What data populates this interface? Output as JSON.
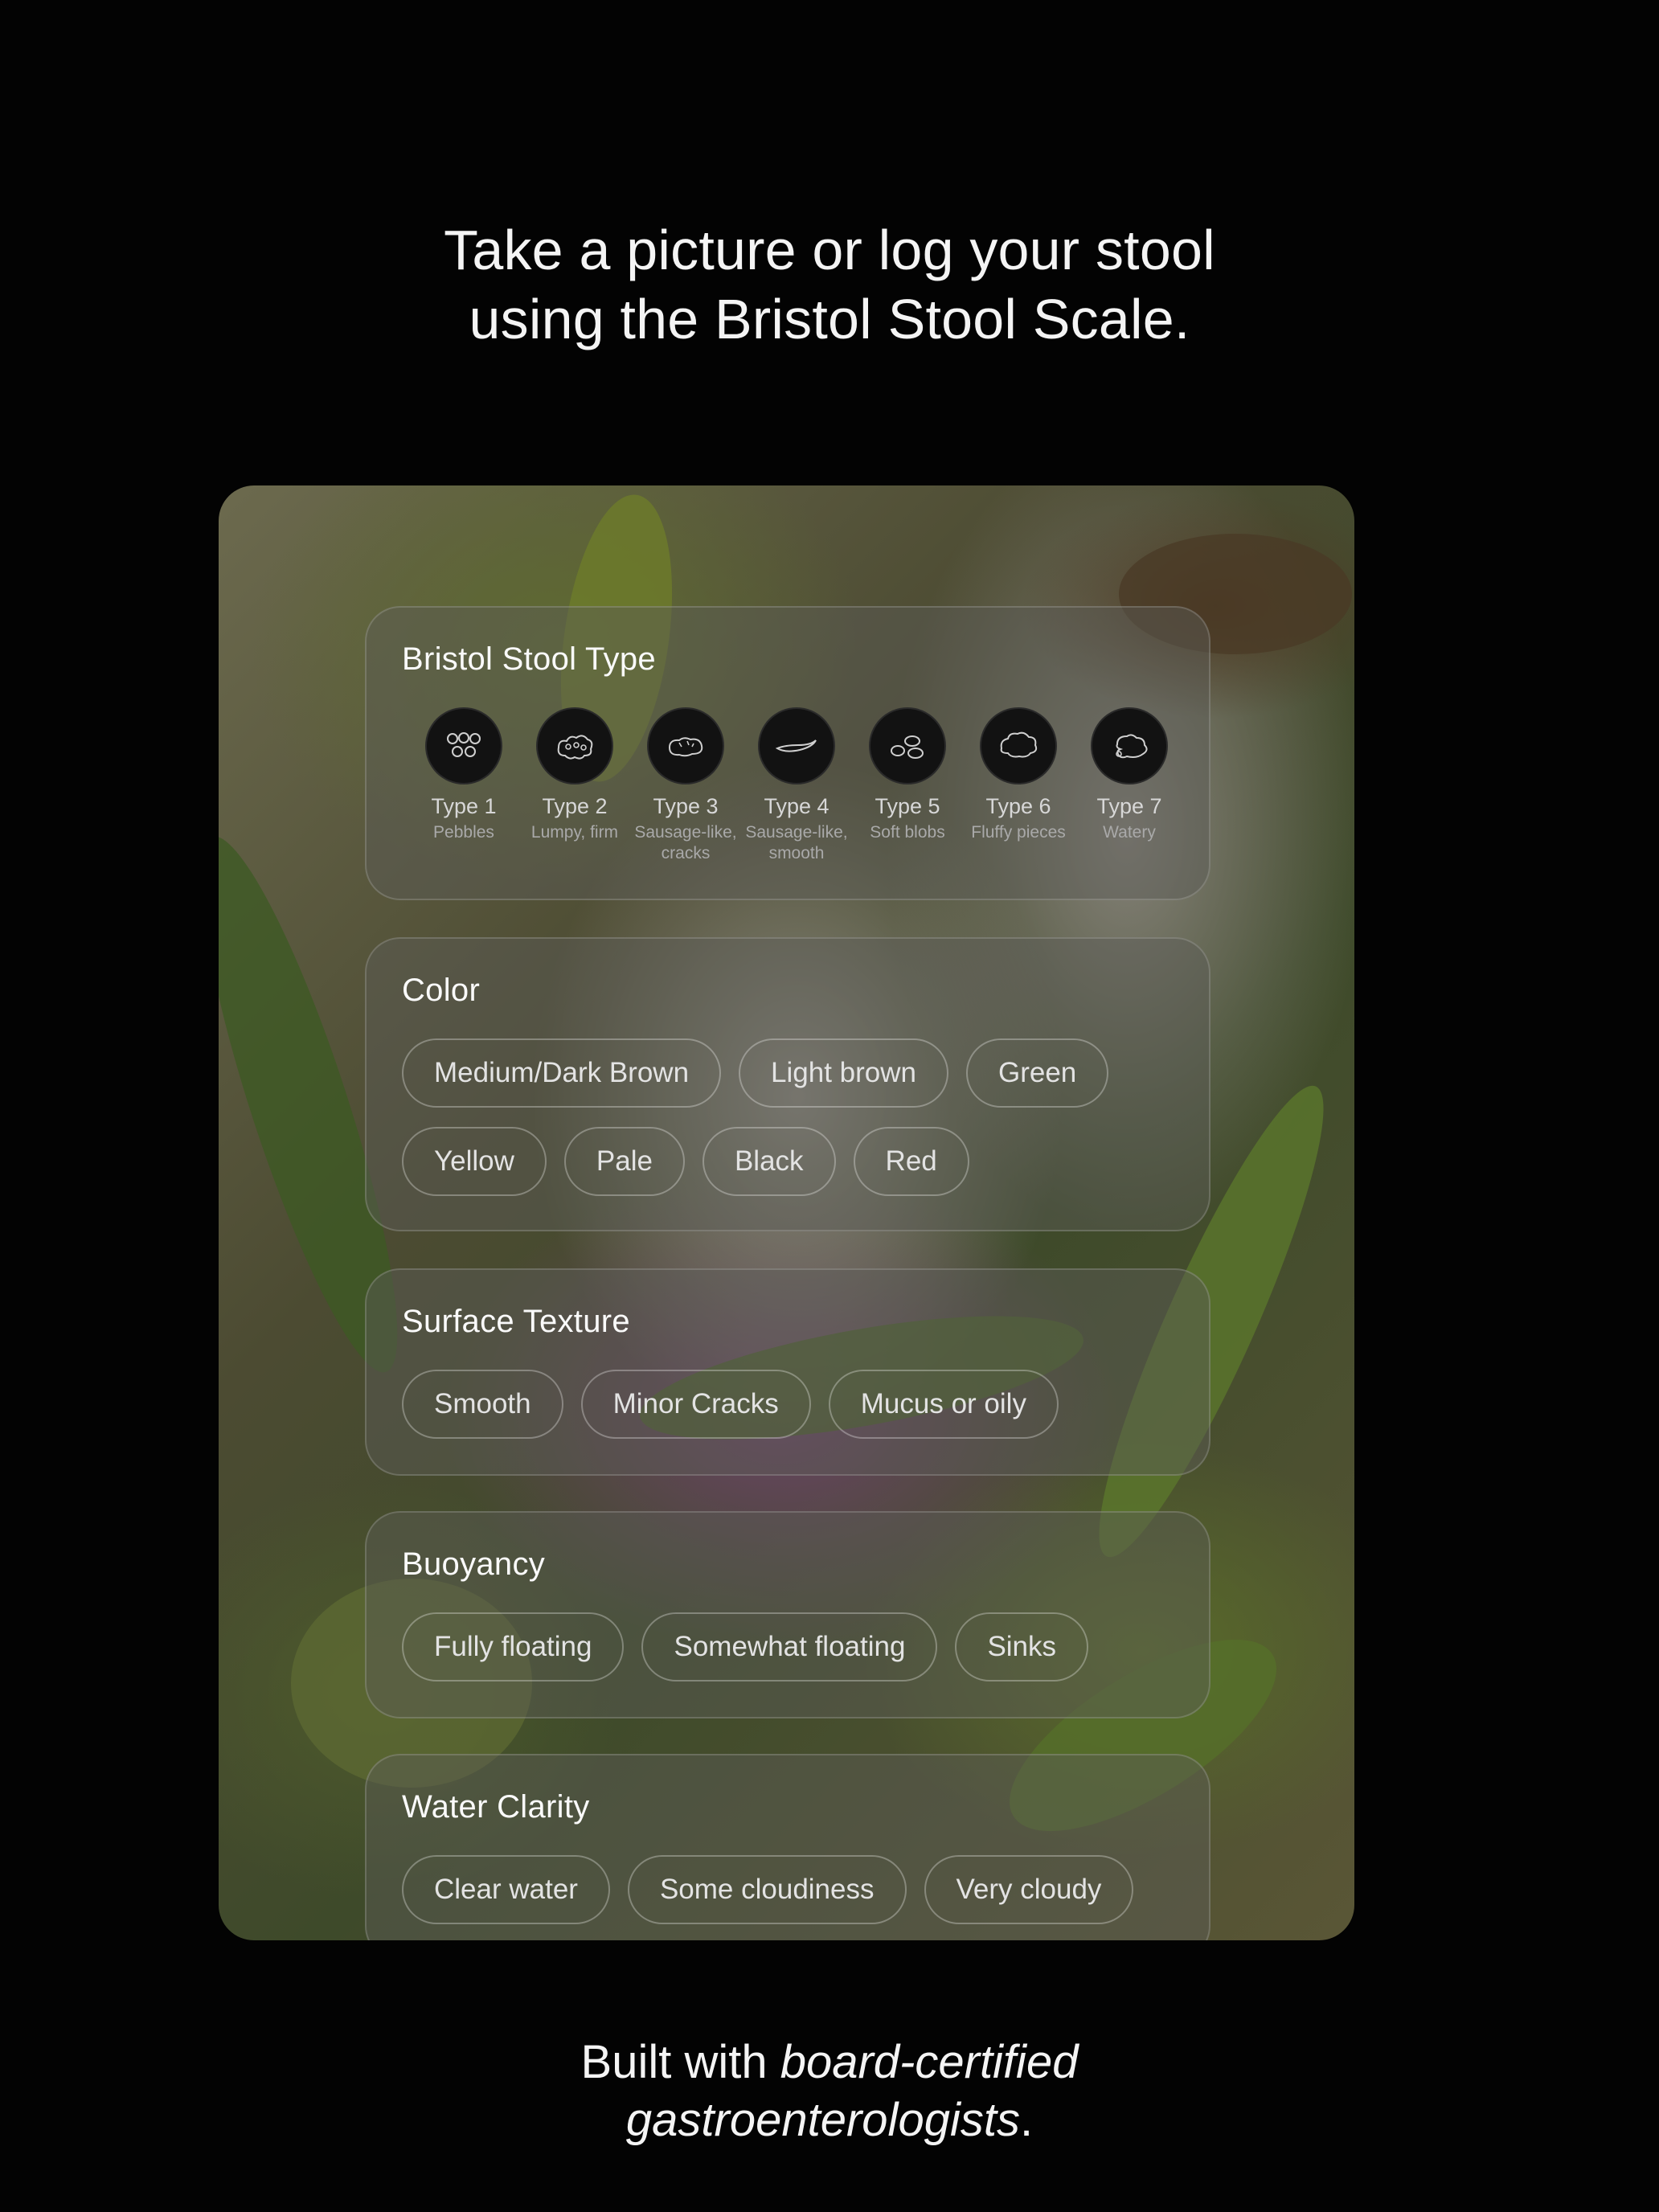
{
  "headline": {
    "line1": "Take a picture or log your stool",
    "line2": "using the Bristol Stool Scale."
  },
  "bristol": {
    "title": "Bristol Stool Type",
    "types": [
      {
        "name": "Type 1",
        "desc": "Pebbles",
        "icon": "pebbles-icon"
      },
      {
        "name": "Type 2",
        "desc": "Lumpy, firm",
        "icon": "lumpy-icon"
      },
      {
        "name": "Type 3",
        "desc": "Sausage-like, cracks",
        "icon": "cracked-sausage-icon"
      },
      {
        "name": "Type 4",
        "desc": "Sausage-like, smooth",
        "icon": "smooth-sausage-icon"
      },
      {
        "name": "Type 5",
        "desc": "Soft blobs",
        "icon": "soft-blobs-icon"
      },
      {
        "name": "Type 6",
        "desc": "Fluffy pieces",
        "icon": "fluffy-icon"
      },
      {
        "name": "Type 7",
        "desc": "Watery",
        "icon": "watery-icon"
      }
    ]
  },
  "color": {
    "title": "Color",
    "options": [
      "Medium/Dark Brown",
      "Light brown",
      "Green",
      "Yellow",
      "Pale",
      "Black",
      "Red"
    ]
  },
  "texture": {
    "title": "Surface Texture",
    "options": [
      "Smooth",
      "Minor Cracks",
      "Mucus or oily"
    ]
  },
  "buoyancy": {
    "title": "Buoyancy",
    "options": [
      "Fully floating",
      "Somewhat floating",
      "Sinks"
    ]
  },
  "clarity": {
    "title": "Water Clarity",
    "options": [
      "Clear water",
      "Some cloudiness",
      "Very cloudy"
    ]
  },
  "footer": {
    "prefix": "Built with ",
    "italic1": "board-certified",
    "italic2": "gastroenterologists",
    "suffix": "."
  }
}
